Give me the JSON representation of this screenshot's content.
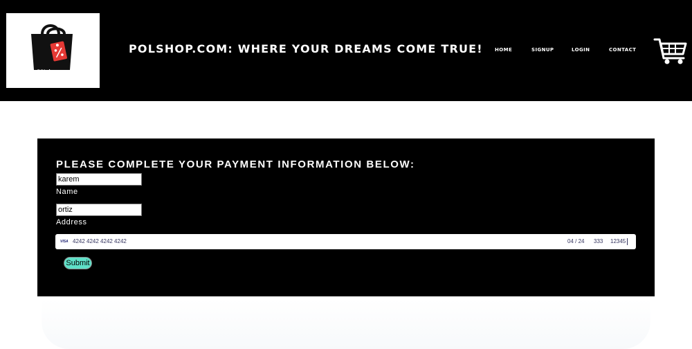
{
  "header": {
    "logo_text": "POLshop.com",
    "site_title": "POLSHOP.COM: WHERE YOUR DREAMS COME TRUE!",
    "nav": {
      "home": "HOME",
      "signup": "SIGNUP",
      "login": "LOGIN",
      "contact": "CONTACT"
    }
  },
  "payment": {
    "title": "PLEASE COMPLETE YOUR PAYMENT INFORMATION BELOW:",
    "name_value": "karem",
    "name_label": "Name",
    "address_value": "ortiz",
    "address_label": "Address",
    "card": {
      "brand": "VISA",
      "number": "4242 4242 4242 4242",
      "expiry": "04 / 24",
      "cvc": "333",
      "zip": "12345"
    },
    "submit_label": "Submit"
  },
  "colors": {
    "header_bg": "#000000",
    "submit_bg": "#5fe0c8",
    "logo_tag": "#e53935"
  }
}
